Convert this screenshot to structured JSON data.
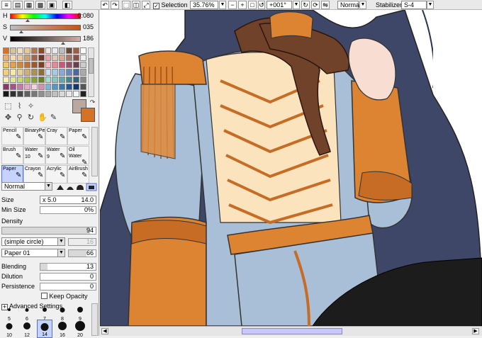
{
  "toolbar": {
    "selection_label": "Selection",
    "zoom": "35.76%",
    "rotation": "+001°",
    "blend_mode": "Normal",
    "stabilizer_label": "Stabilizer",
    "stabilizer_value": "S-4"
  },
  "color": {
    "h_label": "H",
    "h_value": "0:080",
    "s_label": "S",
    "s_value": "035",
    "v_label": "V",
    "v_value": "186",
    "foreground": "#bca79f",
    "background": "#d27328"
  },
  "swatches": [
    "#e07020",
    "#d6c59a",
    "#f0e0c0",
    "#eac898",
    "#b07850",
    "#8a4a28",
    "#f2e8e0",
    "#eaeaea",
    "#bdbdbd",
    "#6a4838",
    "#9a6040",
    "#fff",
    "#e8b070",
    "#f8d8b0",
    "#f0c8a0",
    "#d0a070",
    "#a06848",
    "#703828",
    "#f0a0a0",
    "#e0c8b8",
    "#d8a890",
    "#a87868",
    "#8a5040",
    "#eee",
    "#f8c860",
    "#e8a040",
    "#d08838",
    "#c07030",
    "#a05828",
    "#804020",
    "#f8b8c0",
    "#e88898",
    "#c85878",
    "#985068",
    "#684050",
    "#ccc",
    "#f0d070",
    "#f8e8a0",
    "#e8d090",
    "#d0b070",
    "#b09050",
    "#907030",
    "#c8e0f0",
    "#a8c8e8",
    "#88a8d8",
    "#6888c0",
    "#4868a0",
    "#aaa",
    "#f8f0b0",
    "#e0e890",
    "#c8d870",
    "#a8c050",
    "#88a038",
    "#688028",
    "#a0e0d0",
    "#80c8c0",
    "#60a8a8",
    "#408890",
    "#286878",
    "#888",
    "#8a3868",
    "#a85088",
    "#c878a8",
    "#e8a8c8",
    "#f8d0e0",
    "#d890b0",
    "#70b8e0",
    "#5098c8",
    "#3878b0",
    "#205898",
    "#103870",
    "#555",
    "#181818",
    "#303030",
    "#484848",
    "#606060",
    "#787878",
    "#909090",
    "#a8a8a8",
    "#c0c0c0",
    "#d8d8d8",
    "#e8e8e8",
    "#f4f4f4",
    "#222"
  ],
  "brushes": [
    {
      "name": "Pencil",
      "size": ""
    },
    {
      "name": "BinaryPe",
      "size": ""
    },
    {
      "name": "Cray",
      "size": ""
    },
    {
      "name": "Paper",
      "size": ""
    },
    {
      "name": "Brush",
      "size": ""
    },
    {
      "name": "Water",
      "size": "10"
    },
    {
      "name": "Water",
      "size": "9"
    },
    {
      "name": "Oil Water",
      "size": ""
    },
    {
      "name": "Paper",
      "size": ""
    },
    {
      "name": "Crayon",
      "size": ""
    },
    {
      "name": "Acrylic",
      "size": ""
    },
    {
      "name": "AirBrush",
      "size": ""
    }
  ],
  "brush_settings": {
    "mode": "Normal",
    "size_label": "Size",
    "size_mult": "x 5.0",
    "size_value": "14.0",
    "min_size_label": "Min Size",
    "min_size_value": "0%",
    "density_label": "Density",
    "density_value": "94",
    "shape": "(simple circle)",
    "shape_value": "16",
    "texture": "Paper 01",
    "texture_value": "66",
    "blending_label": "Blending",
    "blending_value": "13",
    "dilution_label": "Dilution",
    "dilution_value": "0",
    "persistence_label": "Persistence",
    "persistence_value": "0",
    "keep_opacity_label": "Keep Opacity",
    "advanced_label": "Advanced Settings"
  },
  "brush_sizes": [
    {
      "label": "5",
      "selected": false
    },
    {
      "label": "6",
      "selected": false
    },
    {
      "label": "7",
      "selected": false
    },
    {
      "label": "8",
      "selected": false
    },
    {
      "label": "9",
      "selected": false
    },
    {
      "label": "10",
      "selected": false
    },
    {
      "label": "12",
      "selected": false
    },
    {
      "label": "14",
      "selected": true
    },
    {
      "label": "16",
      "selected": false
    },
    {
      "label": "20",
      "selected": false
    }
  ]
}
